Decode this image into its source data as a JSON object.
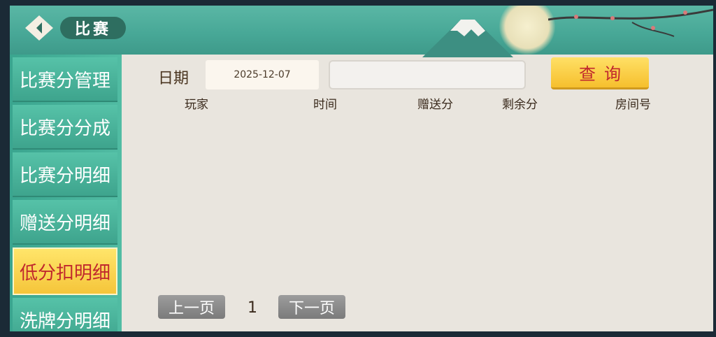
{
  "header": {
    "title": "比赛"
  },
  "sidebar": {
    "items": [
      {
        "label": "比赛分管理"
      },
      {
        "label": "比赛分分成"
      },
      {
        "label": "比赛分明细"
      },
      {
        "label": "赠送分明细"
      },
      {
        "label": "低分扣明细",
        "active": true
      },
      {
        "label": "洗牌分明细"
      }
    ]
  },
  "filter": {
    "date_label": "日期",
    "date_value": "2025-12-07",
    "search_value": "",
    "query_label": "查询"
  },
  "table": {
    "columns": [
      "玩家",
      "时间",
      "赠送分",
      "剩余分",
      "房间号"
    ],
    "rows": []
  },
  "pager": {
    "prev_label": "上一页",
    "page": "1",
    "next_label": "下一页"
  },
  "colors": {
    "header_teal": "#4fb3a0",
    "active_gold": "#f5c53a",
    "active_text": "#c0272d",
    "content_bg": "#e9e5de"
  },
  "icons": {
    "back": "back-arrow-icon"
  }
}
